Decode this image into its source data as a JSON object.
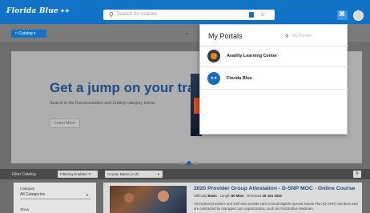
{
  "header": {
    "logo_text": "Florida Blue",
    "logo_mark": "✦✦",
    "search_placeholder": "Search for courses",
    "icons": [
      "search-icon",
      "tag-icon",
      "person-icon",
      "portals-icon",
      "avatar"
    ]
  },
  "subbar": {
    "catalog_label": "□ Catalog ▾",
    "mini_label": "━"
  },
  "hero": {
    "title": "Get a jump on your training!",
    "subtitle": "Search in the Documentation and Coding category below.",
    "button_label": "Learn More",
    "slide_count": 3,
    "active_slide": 2
  },
  "filterbar": {
    "label": "Filter Catalog",
    "chip_label": "Filtering Enabled ✕",
    "sort_label": "Course Name (A-Z)",
    "sort_caret": "▾",
    "search_glyph": "⚲"
  },
  "filters": {
    "category_label": "Category",
    "category_value": "All Categories",
    "category_caret": "▾",
    "show_label": "Show"
  },
  "course": {
    "title": "2020 Provider Group Attestation - D-SNP MOC - Online Course",
    "difficulty_label": "Difficulty",
    "difficulty_value": "Basic",
    "length_label": "Length",
    "length_value": "60 Mins",
    "released_label": "Released",
    "released_value": "25 Jun 2020",
    "description": "All medical providers and staff who provide care to Dual Eligible Special Needs Plan (D-SNP) members and are contracted by managed care organizations, such as Florida Blue Medicare,"
  },
  "portals": {
    "title": "My Portals",
    "search_placeholder": "My Portals",
    "items": [
      {
        "name": "Availity Learning Center",
        "logo": "availity-logo"
      },
      {
        "name": "Florida Blue",
        "logo": "florida-blue-logo",
        "logo_text": "✦✦"
      }
    ]
  },
  "colors": {
    "brand_blue": "#1172c6",
    "title_blue": "#1d4a82",
    "overlay_gray": "#6e6e6e"
  }
}
